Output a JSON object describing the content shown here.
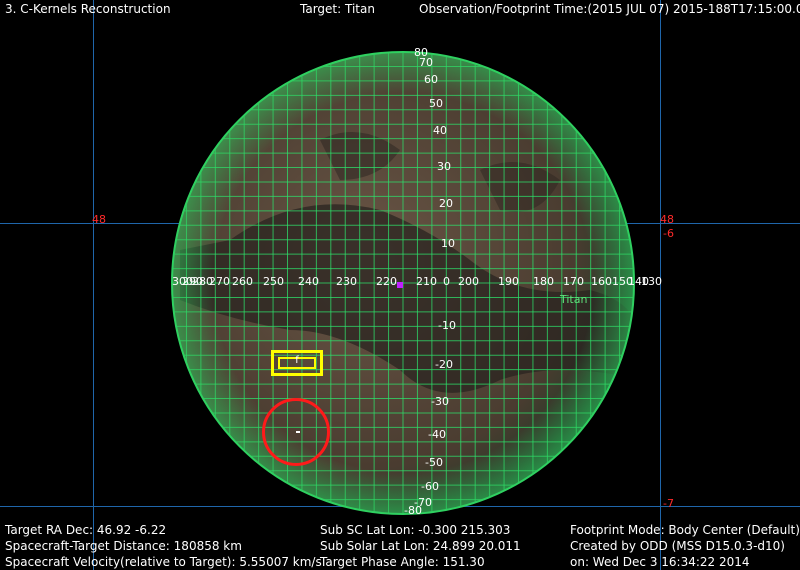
{
  "header": {
    "app_title": "3. C-Kernels Reconstruction",
    "target": "Target: Titan",
    "observation_time": "Observation/Footprint Time:(2015 JUL 07) 2015-188T17:15:00.00"
  },
  "frame_labels": {
    "left_48": "48",
    "right_48": "48",
    "right_neg6": "-6",
    "right_neg7": "-7"
  },
  "globe": {
    "target_name": "Titan",
    "longitude_labels": [
      "300",
      "290",
      "280",
      "270",
      "260",
      "250",
      "240",
      "230",
      "220",
      "210",
      "0",
      "200",
      "190",
      "180",
      "170",
      "160",
      "150",
      "140",
      "130"
    ],
    "latitude_labels": [
      "80",
      "70",
      "60",
      "50",
      "40",
      "30",
      "20",
      "10",
      "-10",
      "-20",
      "-30",
      "-40",
      "-50",
      "-60",
      "-70",
      "-80"
    ],
    "colors": {
      "surface": "#5a4a3c",
      "grid": "#2ee06a",
      "rim": "#2fd060"
    }
  },
  "overlays": {
    "box_label": "f",
    "box_color": "#ffff00",
    "circle_color": "#ff1a1a",
    "subsc_marker_color": "#c020ff"
  },
  "footer": {
    "col1": [
      "Target RA Dec: 46.92   -6.22",
      "Spacecraft-Target Distance:  180858 km",
      "Spacecraft Velocity(relative to Target): 5.55007 km/s"
    ],
    "col2": [
      "Sub SC Lat Lon: -0.300  215.303",
      "Sub Solar Lat Lon: 24.899  20.011",
      "Target Phase Angle: 151.30"
    ],
    "col3": [
      "Footprint Mode: Body Center (Default)",
      "Created by ODD (MSS D15.0.3-d10)",
      "on: Wed Dec  3 16:34:22 2014"
    ]
  }
}
